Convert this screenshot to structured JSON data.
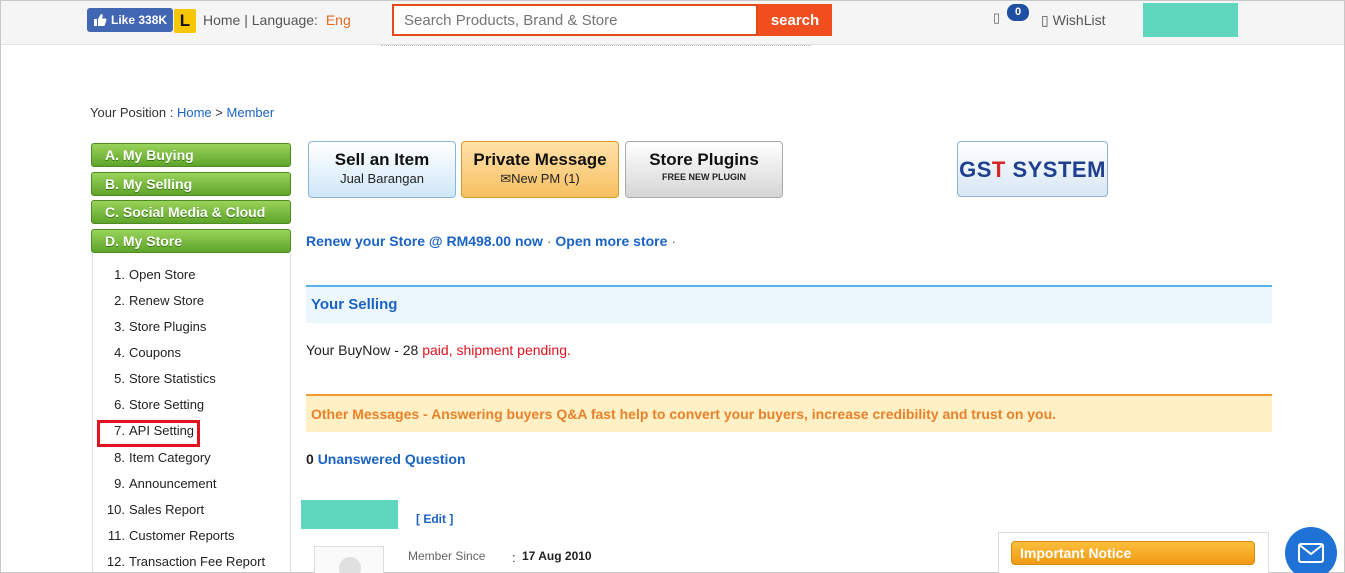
{
  "topbar": {
    "fb_like": "Like 338K",
    "logo_letter": "L",
    "home_language": "Home | Language:",
    "language": "Eng",
    "search_placeholder": "Search Products, Brand & Store",
    "search_button": "search",
    "cart_count": "0",
    "wishlist": "WishList"
  },
  "breadcrumb": {
    "prefix": "Your Position :",
    "home": "Home",
    "sep": ">",
    "member": "Member"
  },
  "sidebar": {
    "categories": [
      "A. My Buying",
      "B. My Selling",
      "C. Social Media & Cloud",
      "D. My Store"
    ],
    "store_items": [
      {
        "num": "1.",
        "label": "Open Store"
      },
      {
        "num": "2.",
        "label": "Renew Store"
      },
      {
        "num": "3.",
        "label": "Store Plugins"
      },
      {
        "num": "4.",
        "label": "Coupons"
      },
      {
        "num": "5.",
        "label": "Store Statistics"
      },
      {
        "num": "6.",
        "label": "Store Setting"
      },
      {
        "num": "7.",
        "label": "API Setting"
      },
      {
        "num": "8.",
        "label": "Item Category"
      },
      {
        "num": "9.",
        "label": "Announcement"
      },
      {
        "num": "10.",
        "label": "Sales Report"
      },
      {
        "num": "11.",
        "label": "Customer Reports"
      },
      {
        "num": "12.",
        "label": "Transaction Fee Report"
      }
    ]
  },
  "buttons": {
    "sell_title": "Sell an Item",
    "sell_sub": "Jual Barangan",
    "pm_title": "Private Message",
    "pm_sub": "New PM  (1)",
    "plugins_title": "Store Plugins",
    "plugins_sub": "FREE NEW PLUGIN",
    "gst_a": "GS",
    "gst_b": "T",
    "gst_c": " SYSTEM"
  },
  "renew": {
    "renew_text": "Renew your Store @ RM498.00 now",
    "open_more": "Open more store",
    "dot": "·"
  },
  "selling": {
    "title": "Your Selling",
    "buynow_label": "Your BuyNow",
    "buynow_sep": " - 28 ",
    "buynow_status": "paid, shipment pending."
  },
  "messages": {
    "other": "Other Messages - Answering buyers Q&A fast help to convert your buyers, increase credibility and trust on you.",
    "unanswered_count": "0",
    "unanswered_label": "Unanswered Question"
  },
  "profile": {
    "edit": "[ Edit ]",
    "member_since_label": "Member Since",
    "colon": ":",
    "member_since": "17 Aug 2010"
  },
  "notice": {
    "title": "Important Notice"
  }
}
